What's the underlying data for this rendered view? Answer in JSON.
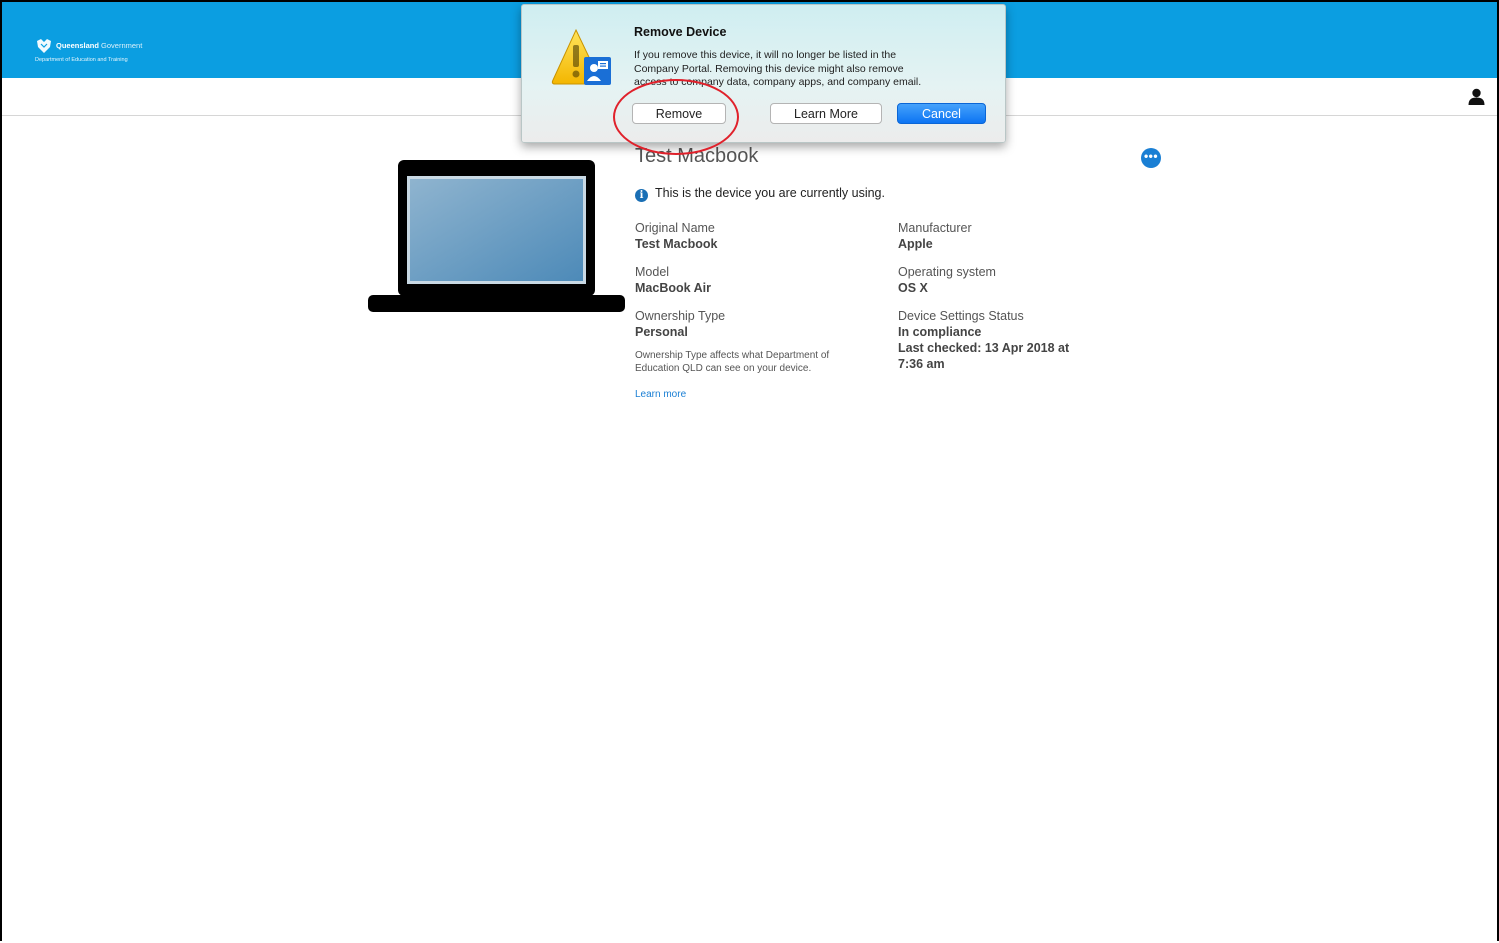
{
  "header": {
    "logo_title_bold": "Queensland",
    "logo_title_light": "Government",
    "logo_subtitle": "Department of Education and Training",
    "background": "#0b9ee1"
  },
  "topbar": {
    "user_icon": "user-icon"
  },
  "device": {
    "title": "Test Macbook",
    "current_notice": "This is the device you are currently using.",
    "fields": {
      "original_name": {
        "label": "Original Name",
        "value": "Test Macbook"
      },
      "manufacturer": {
        "label": "Manufacturer",
        "value": "Apple"
      },
      "model": {
        "label": "Model",
        "value": "MacBook Air"
      },
      "operating_system": {
        "label": "Operating system",
        "value": "OS X"
      },
      "ownership_type": {
        "label": "Ownership Type",
        "value": "Personal"
      },
      "settings_status": {
        "label": "Device Settings Status",
        "value": "In compliance",
        "last_checked_1": "Last checked: 13 Apr 2018 at",
        "last_checked_2": "7:36 am"
      }
    },
    "ownership_note_1": "Ownership Type affects what Department of",
    "ownership_note_2": "Education QLD can see on your device.",
    "learn_more": "Learn more",
    "more_button": "•••"
  },
  "dialog": {
    "title": "Remove Device",
    "message_1": "If you remove this device, it will no longer be listed in the",
    "message_2": "Company Portal. Removing this device might also remove",
    "message_3": "access to company data, company apps, and company email.",
    "buttons": {
      "remove": "Remove",
      "learn_more": "Learn More",
      "cancel": "Cancel"
    }
  },
  "colors": {
    "accent": "#1a7fd4",
    "highlight": "#e0212b"
  }
}
